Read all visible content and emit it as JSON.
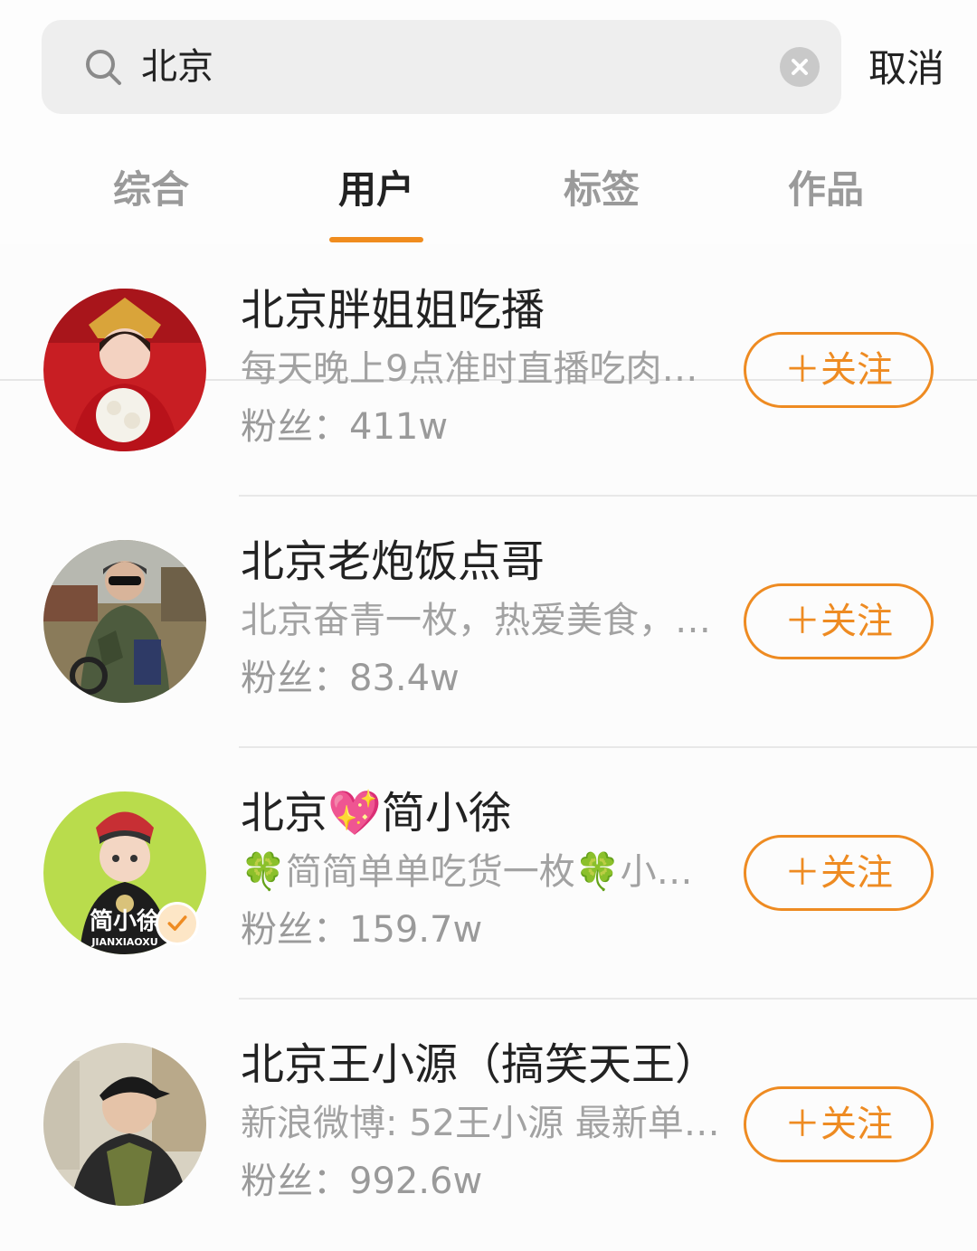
{
  "search": {
    "query": "北京",
    "cancel_label": "取消"
  },
  "tabs": [
    {
      "label": "综合",
      "active": false
    },
    {
      "label": "用户",
      "active": true
    },
    {
      "label": "标签",
      "active": false
    },
    {
      "label": "作品",
      "active": false
    }
  ],
  "users": [
    {
      "name": "北京胖姐姐吃播",
      "desc": "每天晚上9点准时直播吃肉…",
      "fans": "粉丝：411w",
      "follow_label": "＋关注"
    },
    {
      "name": "北京老炮饭点哥",
      "desc": "北京奋青一枚，热爱美食，…",
      "fans": "粉丝：83.4w",
      "follow_label": "＋关注"
    },
    {
      "name": "北京💖简小徐",
      "desc": "🍀简简单单吃货一枚🍀小…",
      "fans": "粉丝：159.7w",
      "follow_label": "＋关注",
      "avatar_text": "简小徐",
      "avatar_subtext": "JIANXIAOXU"
    },
    {
      "name": "北京王小源（搞笑天王）",
      "desc": "新浪微博: 52王小源 最新单…",
      "fans": "粉丝：992.6w",
      "follow_label": "＋关注"
    }
  ],
  "colors": {
    "accent": "#ee8b22",
    "tab_underline": "#f08c1e"
  }
}
